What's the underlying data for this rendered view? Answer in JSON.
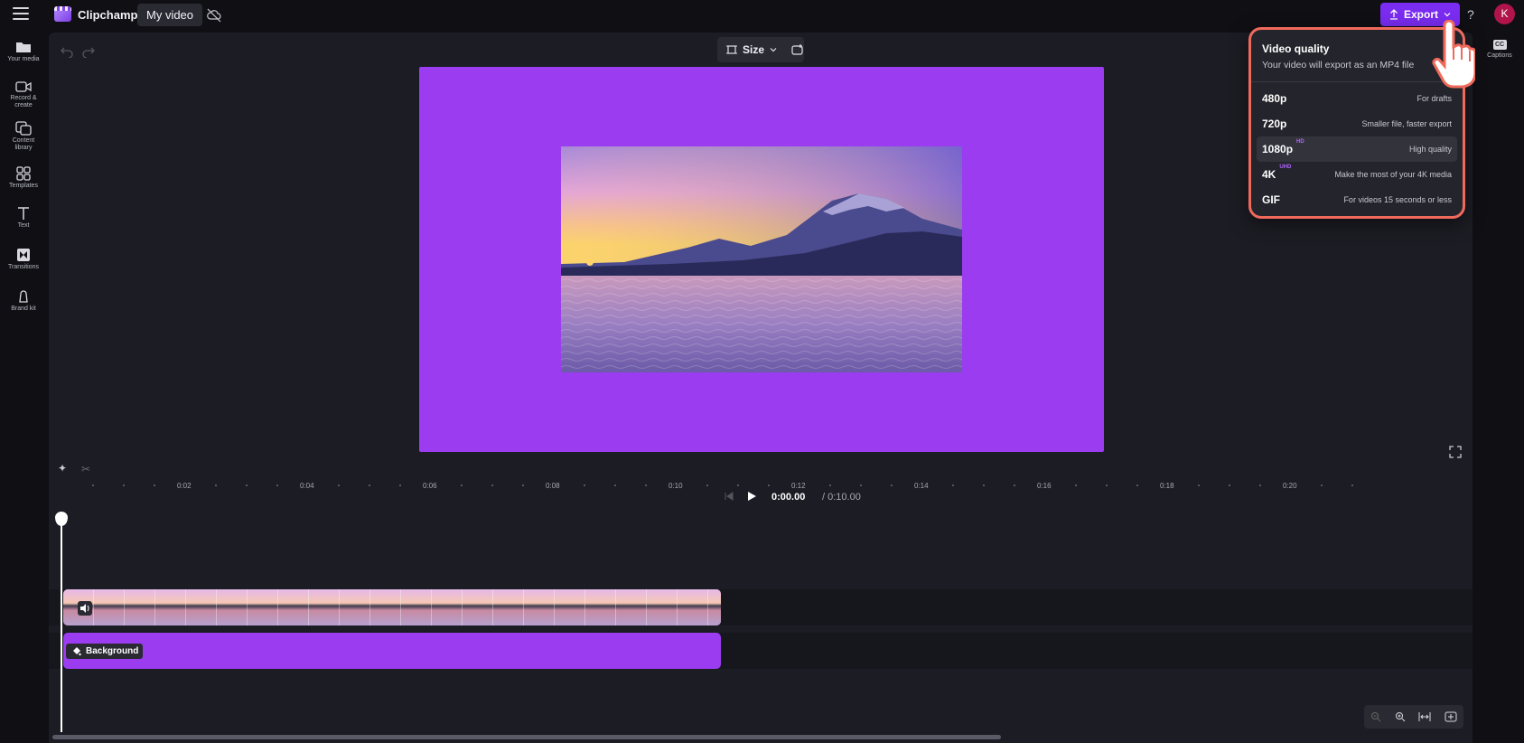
{
  "app": {
    "name": "Clipchamp",
    "project_tab": "My video"
  },
  "header": {
    "export_label": "Export",
    "help_label": "?",
    "avatar_initial": "K"
  },
  "sidebar": {
    "items": [
      {
        "label": "Your media",
        "icon": "folder-icon"
      },
      {
        "label": "Record & create",
        "icon": "camera-icon"
      },
      {
        "label": "Content library",
        "icon": "library-icon"
      },
      {
        "label": "Templates",
        "icon": "templates-icon"
      },
      {
        "label": "Text",
        "icon": "text-icon"
      },
      {
        "label": "Transitions",
        "icon": "transitions-icon"
      },
      {
        "label": "Brand kit",
        "icon": "brand-kit-icon"
      }
    ]
  },
  "preview": {
    "size_label": "Size",
    "canvas_color": "#9b3cf0"
  },
  "right_rail": {
    "captions_label": "Captions",
    "captions_badge": "CC"
  },
  "export_menu": {
    "title": "Video quality",
    "subtitle": "Your video will export as an MP4 file",
    "options": [
      {
        "resolution": "480p",
        "badge": "",
        "description": "For drafts",
        "selected": false
      },
      {
        "resolution": "720p",
        "badge": "",
        "description": "Smaller file, faster export",
        "selected": false
      },
      {
        "resolution": "1080p",
        "badge": "HD",
        "description": "High quality",
        "selected": true
      },
      {
        "resolution": "4K",
        "badge": "UHD",
        "description": "Make the most of your 4K media",
        "selected": false
      },
      {
        "resolution": "GIF",
        "badge": "",
        "description": "For videos 15 seconds or less",
        "selected": false
      }
    ]
  },
  "playback": {
    "current_time": "0:00.00",
    "total_time": "/ 0:10.00"
  },
  "timeline": {
    "ruler_labels": [
      "0:02",
      "0:04",
      "0:06",
      "0:08",
      "0:10",
      "0:12",
      "0:14",
      "0:16",
      "0:18",
      "0:20"
    ],
    "background_clip_label": "Background"
  },
  "colors": {
    "accent": "#7a2cf0",
    "highlight_border": "#f06a5c",
    "avatar": "#b0144a"
  }
}
